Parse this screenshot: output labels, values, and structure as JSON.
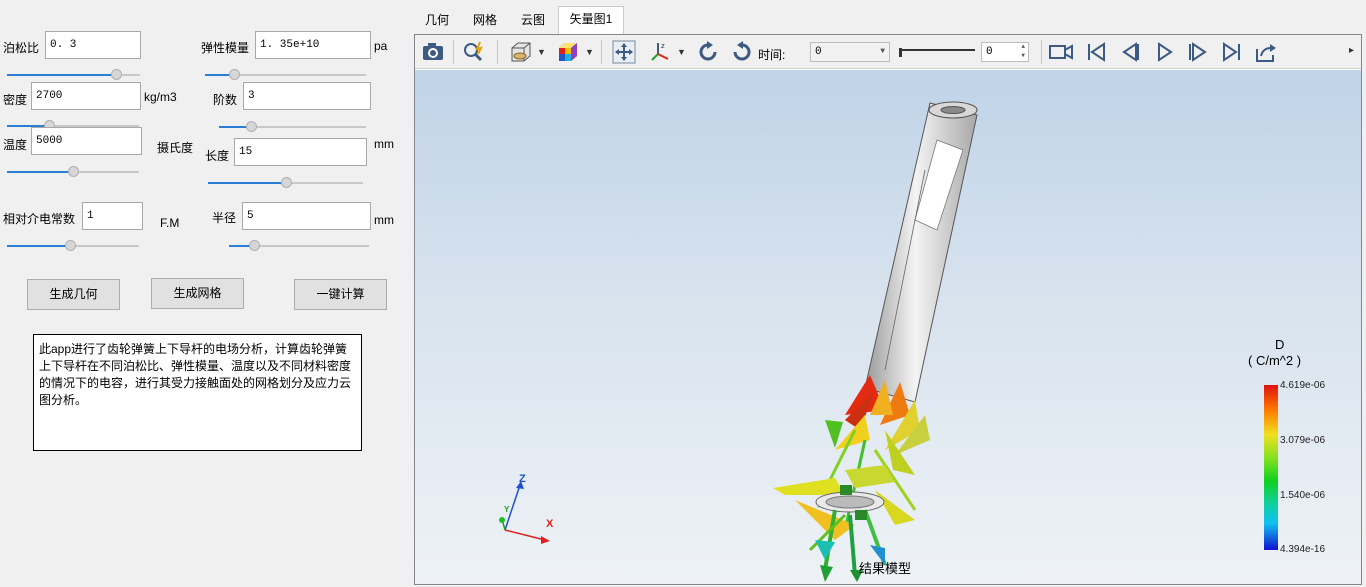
{
  "params": {
    "poisson_label": "泊松比",
    "poisson_value": "0. 3",
    "youngs_label": "弹性模量",
    "youngs_value": "1. 35e+10",
    "youngs_unit": "pa",
    "density_label": "密度",
    "density_value": "2700",
    "density_unit": "kg/m3",
    "order_label": "阶数",
    "order_value": "3",
    "temp_label": "温度",
    "temp_value": "5000",
    "temp_unit": "摄氏度",
    "length_label": "长度",
    "length_value": "15",
    "length_unit": "mm",
    "permittivity_label": "相对介电常数",
    "permittivity_value": "1",
    "permittivity_unit": "F.M",
    "radius_label": "半径",
    "radius_value": "5",
    "radius_unit": "mm"
  },
  "sliders": {
    "poisson": 0.82,
    "youngs": 0.18,
    "density": 0.32,
    "order": 0.22,
    "temp": 0.5,
    "length": 0.5,
    "permittivity": 0.48,
    "radius": 0.18
  },
  "buttons": {
    "gen_geometry": "生成几何",
    "gen_mesh": "生成网格",
    "one_click": "一键计算"
  },
  "description": "此app进行了齿轮弹簧上下导杆的电场分析，计算齿轮弹簧上下导杆在不同泊松比、弹性模量、温度以及不同材料密度的情况下的电容，进行其受力接触面处的网格划分及应力云图分析。",
  "tabs": [
    {
      "label": "几何",
      "active": false
    },
    {
      "label": "网格",
      "active": false
    },
    {
      "label": "云图",
      "active": false
    },
    {
      "label": "矢量图1",
      "active": true
    }
  ],
  "toolbar": {
    "time_label": "时间:",
    "time_combo": "0",
    "time_spin": "0"
  },
  "viewer": {
    "caption": "结果模型",
    "legend_title": "D",
    "legend_unit": "( C/m^2 )",
    "legend_ticks": [
      "4.619e-06",
      "3.079e-06",
      "1.540e-06",
      "4.394e-16"
    ],
    "axes": {
      "x": "X",
      "y": "Y",
      "z": "Z"
    }
  },
  "icons": [
    "camera-icon",
    "zoom-magic-icon",
    "box-view-icon",
    "color-cube-icon",
    "fit-icon",
    "axes-orient-icon",
    "rotate-cw-icon",
    "rotate-ccw-icon",
    "video-icon",
    "first-frame-icon",
    "prev-frame-icon",
    "play-icon",
    "next-frame-icon",
    "last-frame-icon",
    "export-icon"
  ],
  "colors": {
    "accent": "#2a7fd4",
    "legend_top": "#e01010",
    "legend_bottom": "#1010d0"
  }
}
